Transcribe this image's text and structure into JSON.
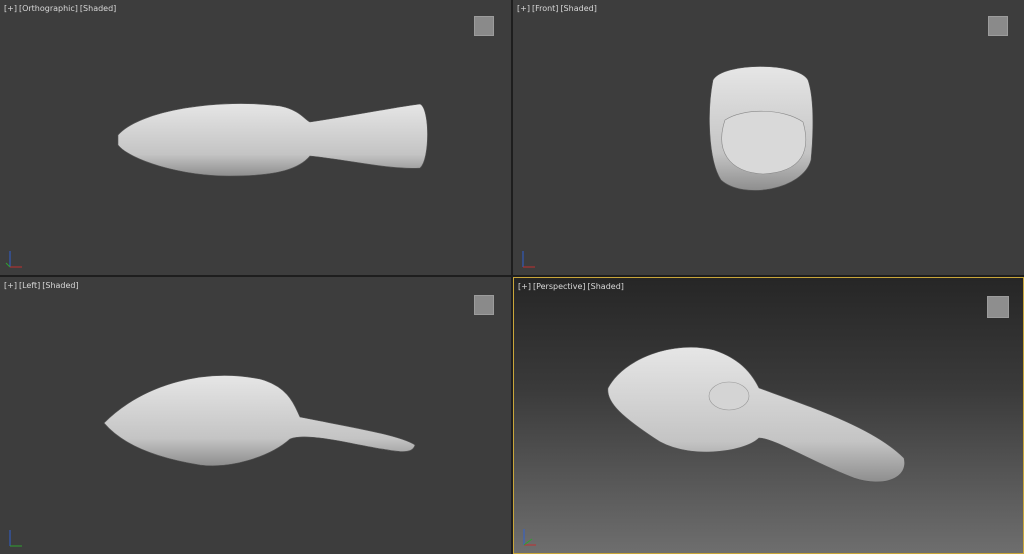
{
  "viewports": [
    {
      "plus": "[+]",
      "view": "[Orthographic]",
      "shading": "[Shaded]",
      "active": false
    },
    {
      "plus": "[+]",
      "view": "[Front]",
      "shading": "[Shaded]",
      "active": false
    },
    {
      "plus": "[+]",
      "view": "[Left]",
      "shading": "[Shaded]",
      "active": false
    },
    {
      "plus": "[+]",
      "view": "[Perspective]",
      "shading": "[Shaded]",
      "active": true
    }
  ],
  "colors": {
    "viewport_bg": "#3d3d3d",
    "active_border": "#c9a63a",
    "model": "#cfcfcf"
  }
}
